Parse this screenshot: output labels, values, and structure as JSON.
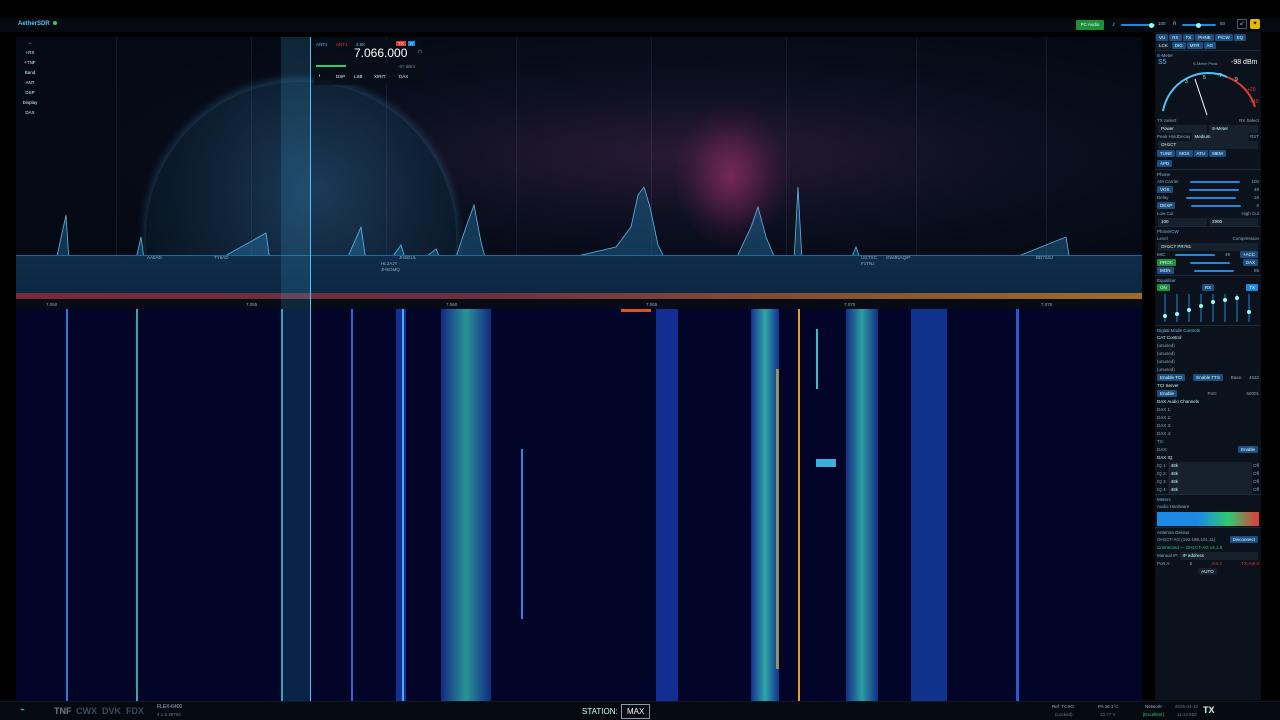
{
  "app": {
    "title": "AetherSDR",
    "pc_audio": "PC Audio",
    "left_value": "100",
    "right_value": "50"
  },
  "left_menu": [
    "+RX",
    "+TNF",
    "Band",
    "ANT",
    "DSP",
    "Display",
    "DAX"
  ],
  "slice": {
    "ant_rx": "ANT1",
    "ant_tx": "ANT1",
    "filter": "2.5K",
    "letter": "A",
    "tx": "TX",
    "frequency": "7.066.000",
    "level": "-57 dBm",
    "buttons": [
      "DSP",
      "LSB",
      "X/RIT",
      "DAX"
    ]
  },
  "spots": [
    {
      "call": "AA5AD",
      "left": "146"
    },
    {
      "call": "TY5AD",
      "left": "213"
    },
    {
      "call": "HL2AJY",
      "left": "380"
    },
    {
      "call": "JH5GUL",
      "left": "398"
    },
    {
      "call": "JH5OMQ",
      "left": "380"
    },
    {
      "call": "UI1TXC",
      "left": "860"
    },
    {
      "call": "GW4NAQ/P",
      "left": "885"
    },
    {
      "call": "F1TNJ",
      "left": "860"
    },
    {
      "call": "BD7SSJ",
      "left": "1036"
    }
  ],
  "freq_axis": [
    "7.050",
    "7.055",
    "7.060",
    "7.065",
    "7.070",
    "7.075",
    "7.080",
    "7.085"
  ],
  "right": {
    "top_buttons": [
      "VU",
      "RX",
      "TX",
      "PHNE",
      "P/CW",
      "EQ",
      "LCK",
      "DIG",
      "MTR",
      "AG"
    ],
    "smeter": {
      "label": "S-Meter",
      "value": "S5",
      "dbm": "-98 dBm",
      "peak_label": "S-Meter Peak",
      "scale": [
        "1",
        "3",
        "5",
        "7",
        "9",
        "+20",
        "+40",
        "+60"
      ]
    },
    "tx_select": "TX Select",
    "rx_select": "RX Select",
    "tx_value": "Power",
    "rx_value": "S-Meter",
    "peak_hold": "Peak Hold",
    "decay": "Decay",
    "decay_value": "Medium",
    "rst": "RST",
    "profile": "OH1CT",
    "tx_buttons": [
      "TUNE",
      "MOX",
      "ATU",
      "MEM"
    ],
    "apd": "APD",
    "phone": "Phone",
    "am_carrier": "AM Carrier",
    "am_carrier_val": "100",
    "vox": "VOX",
    "vox_val": "49",
    "delay": "Delay",
    "delay_val": "16",
    "dexp": "DEXP",
    "dexp_val": "0",
    "low_cut": "Low Cut",
    "high_cut": "High Cut",
    "low_cut_val": "100",
    "high_cut_val": "2900",
    "phone_cw": "Phone/CW",
    "level": "Level",
    "compression": "Compression",
    "mic_profile": "OH1CT PR781",
    "mic": "MIC",
    "mic_val": "49",
    "acc": "+ACC",
    "proc": "PROC",
    "dax": "DAX",
    "mon": "MON",
    "mon_val": "85",
    "equalizer": "Equalizer",
    "eq_on": "ON",
    "eq_rx": "RX",
    "eq_tx": "TX",
    "digital": "Digital Mode Controls",
    "cat": "CAT Control",
    "cat_rows": [
      "(unused)",
      "(unused)",
      "(unused)",
      "(unused)"
    ],
    "enable_tci": "Enable TCI",
    "enable_tts": "Enable TTS",
    "base_label": "Base:",
    "base": "4532",
    "tci_server": "TCI Server",
    "enable": "Enable",
    "port_label": "Port:",
    "port": "50001",
    "dax_audio": "DAX Audio Channels",
    "dax_rows": [
      "DAX 1:",
      "DAX 2:",
      "DAX 3:",
      "DAX 4:",
      "TX:"
    ],
    "dax_label": "DAX:",
    "dax_enable": "Enable",
    "dax_iq": "DAX IQ",
    "iq_rows": [
      "IQ 1:",
      "IQ 2:",
      "IQ 3:",
      "IQ 4:"
    ],
    "iq_rate": "48k",
    "iq_state": "Off",
    "meters": "Meters",
    "audio_hardware": "Audio Hardware",
    "antenna_genius": "Antenna Genius",
    "ag_name": "OH1CT-AG (192.168.101.11)",
    "disconnect": "Disconnect",
    "connected": "Connected — OH1CT-AG v4.1.8",
    "manual_ip": "Manual IP:",
    "manual_ip_ph": "IP address",
    "port_a": "Port A:",
    "port_a_val": "5",
    "port_a_ant": "Ant 2",
    "port_a_tx": "TX-Ant 2",
    "auto": "AUTO"
  },
  "bottom": {
    "modes": [
      "TNF",
      "CWX",
      "DVK",
      "FDX"
    ],
    "radio": "FLEX-6400",
    "version": "4.1.5.39794",
    "station_label": "STATION:",
    "station": "MAX",
    "ref": "Ref: TCXO",
    "ref_state": "(Locked)",
    "pa": "PA 26.1°C",
    "volt": "13.77 V",
    "network": "Network:",
    "network_state": "[Excellent]",
    "date": "2026-04-12",
    "time": "11:12:55Z",
    "tx": "TX"
  },
  "colors": {
    "accent": "#4fc3f7",
    "green": "#2ecc71",
    "red": "#e53935",
    "button": "#1c4f80"
  }
}
